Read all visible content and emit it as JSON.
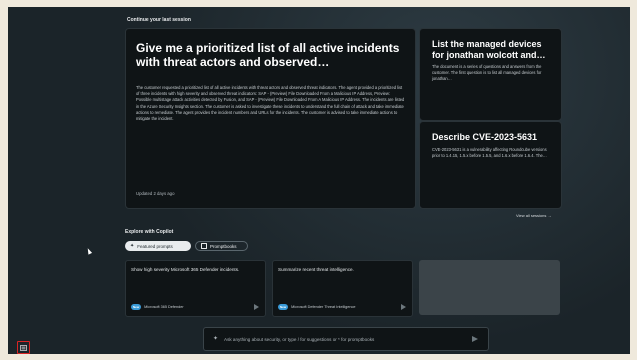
{
  "continue_section": {
    "title": "Continue your last session",
    "featured_session": {
      "title": "Give me a prioritized list of all active incidents with threat actors and observed…",
      "body": "The customer requested a prioritized list of all active incidents with threat actors and observed threat indicators. The agent provided a prioritized list of three incidents with high severity and observed threat indicators: SAP - (Preview) File Downloaded From a Malicious IP Address, Preview: Possible multistage attack activities detected by Fusion, and SAP - (Preview) File Downloaded From A Malicious IP Address. The incidents are listed in the Azure Security Insights section. The customer is asked to investigate these incidents to understand the full chain of attack and take immediate actions to remediate. The agent provides the incident numbers and URLs for the incidents. The customer is advised to take immediate actions to mitigate the incident.",
      "updated": "Updated 2 days ago"
    },
    "side_sessions": [
      {
        "title": "List the managed devices for jonathan wolcott and…",
        "body": "The document is a series of questions and answers from the customer. The first question is to list all managed devices for jonathan…"
      },
      {
        "title": "Describe CVE-2023-5631",
        "body": "CVE-2023-5631 is a vulnerability affecting Roundcube versions prior to 1.4.15, 1.5.x before 1.5.5, and 1.6.x before 1.6.4. The…"
      }
    ],
    "view_all": "View all sessions →"
  },
  "explore": {
    "title": "Explore with Copilot",
    "tabs": [
      {
        "label": "Featured prompts",
        "active": true,
        "icon": "sparkle-icon"
      },
      {
        "label": "Promptbooks",
        "active": false,
        "icon": "book-icon"
      }
    ],
    "prompts": [
      {
        "text": "Show high severity Microsoft 365 Defender incidents.",
        "badge": "New",
        "source": "Microsoft 365 Defender"
      },
      {
        "text": "Summarize recent threat intelligence.",
        "badge": "New",
        "source": "Microsoft Defender Threat Intelligence"
      }
    ]
  },
  "prompt_bar": {
    "placeholder": "Ask anything about security, or type / for suggestions or * for promptbooks"
  },
  "colors": {
    "background": "#1b2429",
    "card": "#0f1416",
    "accent_badge": "#3a9bd8",
    "highlight_box": "#d92424"
  },
  "icons": {
    "menu": "menu-icon",
    "send": "send-icon",
    "sparkle": "sparkle-icon"
  }
}
